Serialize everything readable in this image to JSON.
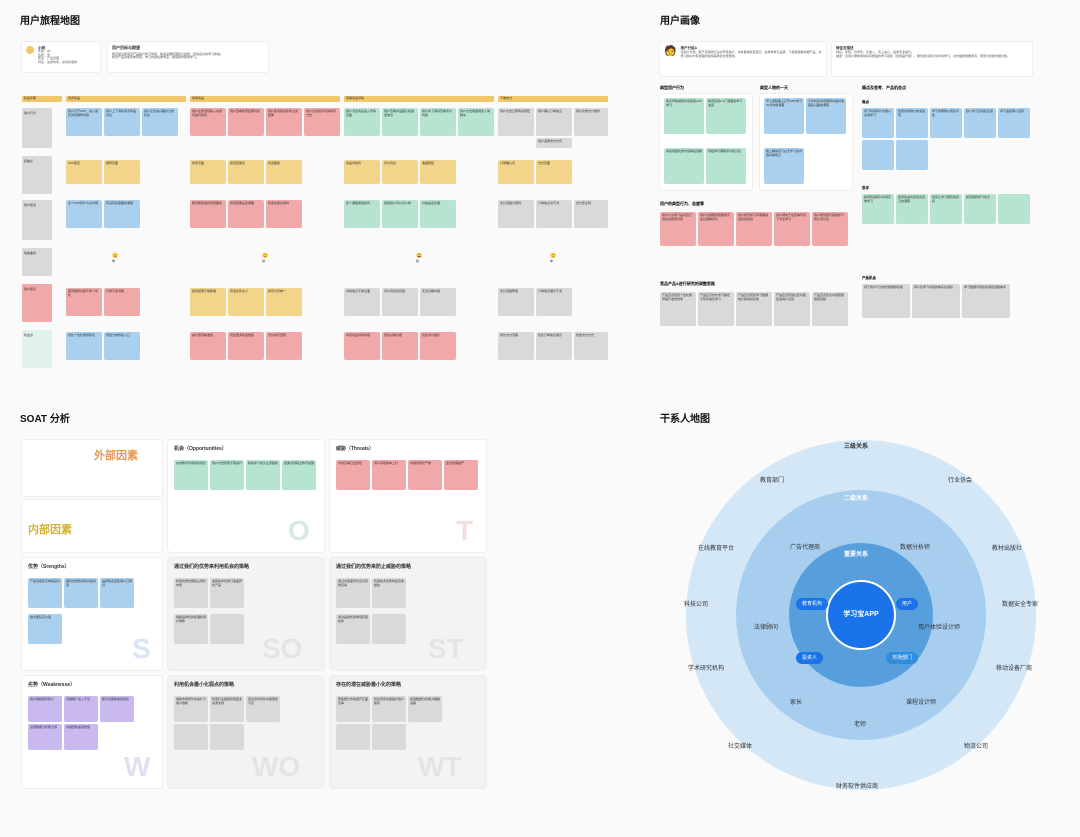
{
  "journey": {
    "title": "用户旅程地图",
    "persona": {
      "name": "小明",
      "meta": "年龄：28\n性别：男\n职业：产品经理\n特征：追求效率，喜欢新事物"
    },
    "goal": {
      "title": "用户目标与期望",
      "body": "希望通过使用该产品提升学习效率，快速掌握所需知识技能，获得良好的学习体验。\n希望产品功能简单易用，学习内容优质丰富，能够随时随地学习。"
    },
    "stageHeader": "阶段步骤",
    "stages": [
      "浏览商品",
      "搜索商品",
      "查看商品详情",
      "下单支付"
    ],
    "rows": [
      {
        "label": "用户行为",
        "cells": [
          [
            "用户打开APP，进入首页浏览推荐内容",
            "用户上下滑动浏览商品列表",
            "用户点击感兴趣的分类标签"
          ],
          [
            "用户在搜索框输入关键词进行搜索",
            "用户查看搜索结果列表",
            "用户使用筛选条件过滤结果",
            "用户点击排序切换排序方式"
          ],
          [
            "用户点击商品进入详情页面",
            "用户查看商品图片和描述信息",
            "用户向下滑动查看评价内容",
            "用户点击收藏或加入购物车"
          ],
          [
            "用户点击立即购买按钮",
            "用户确认订单信息",
            "用户选择支付方式",
            "用户完成支付操作"
          ]
        ]
      },
      {
        "label": "接触点",
        "cells": [
          [
            "APP首页",
            "推荐页面"
          ],
          [
            "搜索页面",
            "搜索结果页",
            "筛选面板"
          ],
          [
            "商品详情页",
            "评价列表",
            "收藏按钮"
          ],
          [
            "订单确认页",
            "支付页面"
          ]
        ]
      },
      {
        "label": "用户想法",
        "cells": [
          [
            "这个APP有什么好内容",
            "有没有我需要的课程"
          ],
          [
            "希望能快速找到想要的",
            "搜索结果是否准确",
            "筛选功能好用吗"
          ],
          [
            "这个课程质量如何",
            "其他用户评价怎么样",
            "价格是否合理"
          ],
          [
            "支付流程方便吗",
            "订单信息对不对",
            "支付安全吗"
          ]
        ]
      },
      {
        "label": "情绪曲线",
        "emoji": [
          "😐",
          "😊",
          "😄",
          "🙂"
        ],
        "labels": [
          "中",
          "好",
          "好",
          "中"
        ]
      },
      {
        "label": "用户痛点",
        "cells": [
          [
            "首页推荐内容不够个性化",
            "分类不够清晰"
          ],
          [
            "搜索结果不够精准",
            "筛选条件太少",
            "排序方式单一"
          ],
          [
            "详情信息不够全面",
            "评价真实性存疑",
            "无法试看内容"
          ],
          [
            "支付流程繁琐",
            "订单信息展示不清"
          ]
        ]
      },
      {
        "label": "机会点",
        "cells": [
          [
            "优化个性化推荐算法",
            "增加分类导航入口"
          ],
          [
            "提升搜索精准度",
            "增加更多筛选维度",
            "优化排序逻辑"
          ],
          [
            "丰富商品详情内容",
            "增加试看功能",
            "优化评价展示"
          ],
          [
            "简化支付流程",
            "优化订单信息展示",
            "增加支付方式"
          ]
        ]
      }
    ]
  },
  "persona": {
    "title": "用户画像",
    "card": {
      "title": "用户分组A",
      "body": "该用户分组：属于互联网行业的年轻用户，对新事物接受度高，追求效率与品质，习惯使用移动端产品，对学习类APP有较强的使用需求和付费意愿。"
    },
    "card2": {
      "title": "特征及描述",
      "body": "特征：年轻、高学历、高收入、有上进心、追求专业提升。\n描述：该用户群体通常具有较强的学习动机（自我提升型），希望通过碎片化时间学习，对内容质量要求高，愿意为优质内容付费。"
    },
    "cols": [
      {
        "title": "典型用户行为",
        "pane": "mint",
        "items": [
          "每天早晚通勤时间使用APP学习",
          "每周完成2-3门课程的学习进度",
          "",
          "喜欢收藏优质内容稍后观看",
          "积极参与课程评价和讨论"
        ]
      },
      {
        "title": "典型人物的一天",
        "pane": "skyblue",
        "items": [
          "早上通勤路上打开APP学习30分钟新课程",
          "",
          "午休时间浏览推荐内容并收藏感兴趣的课程",
          "",
          "晚上睡前复习白天学习的内容并做笔记"
        ]
      },
      {
        "title": "痛点及思考、产品机会点",
        "pane": "white",
        "sub": [
          {
            "t": "痛点",
            "color": "blue",
            "items": [
              "学习时间碎片化难以系统学习",
              "优质内容难以快速发现",
              "学习效果难以量化评估",
              "缺少学习互动和反馈",
              "学习进度难以坚持",
              "",
              ""
            ]
          },
          {
            "t": "思考",
            "color": "green",
            "items": [
              "如何利用碎片时间高效学习",
              "如何快速找到适合自己的课程",
              "如何让学习更有成就感",
              "",
              "如何保持学习动力"
            ]
          }
        ]
      }
    ],
    "row2label": "用户的典型行为、态度等",
    "row2": [
      "用户认为学习是对自己的投资愿意付费",
      "用户对课程质量要求高会仔细看评价",
      "用户希望学习有明确进度和成就感",
      "用户倾向于在安静环境下专注学习",
      "用户希望能与其他学习者交流讨论"
    ],
    "row3label": "竞品产品A进行研究的调整思路",
    "row3": [
      "产品应该增加个性化推荐提升发现效率",
      "产品应该优化学习路径引导系统化学习",
      "产品应该增加学习数据统计和成就系统",
      "产品应该增加社区功能促进用户互动",
      "产品应该优化内容质量把控机制"
    ],
    "side": {
      "label": "产品机会",
      "items": [
        "基于用户行为的智能推荐系统",
        "碎片化学习内容的体系化组织",
        "学习数据可视化和成就激励体系"
      ]
    }
  },
  "soat": {
    "title": "SOAT 分析",
    "ext": "外部因素",
    "int": "内部因素",
    "panels": {
      "O": {
        "title": "机会（Opportunities）",
        "items": [
          "在线教育市场持续增长",
          "用户付费意愿不断提升",
          "移动学习成为主流趋势",
          "政策支持职业教育发展"
        ]
      },
      "T": {
        "title": "威胁（Threats）",
        "items": [
          "市场竞争日益激烈",
          "用户获取成本上升",
          "内容同质化严重",
          "监管政策趋严"
        ]
      },
      "S": {
        "title": "优势（Srengths）",
        "items": [
          "产品功能完善体验良好",
          "拥有优质师资和内容资源",
          "品牌知名度和用户口碑好",
          "技术团队实力强"
        ]
      },
      "SO": {
        "title": "通过我们的优势来利用机会的策略",
        "items": [
          "利用优质内容抢占增长市场",
          "发挥技术优势打造差异化产品",
          "借助品牌优势拓展新用户群体",
          "",
          ""
        ]
      },
      "ST": {
        "title": "通过我们的优势来防止威胁的策略",
        "items": [
          "通过内容差异化应对同质竞争",
          "利用技术优势构建竞争壁垒",
          "通过品牌优势降低获客成本",
          "",
          ""
        ]
      },
      "W": {
        "title": "劣势（Weaknesse）",
        "items": [
          "用户规模相对较小",
          "营销推广投入不足",
          "部分功能体验待优化",
          "运营数据分析能力弱",
          "内容更新速度较慢"
        ]
      },
      "WO": {
        "title": "利用机会最小化弱点的策略",
        "items": [
          "借助市场增长快速扩大用户规模",
          "利用行业趋势获取更多资源支持",
          "通过合作弥补内容更新不足",
          "",
          ""
        ]
      },
      "WT": {
        "title": "存在的潜在威胁最小化的策略",
        "items": [
          "聚焦细分市场避开正面竞争",
          "优化现有功能提升用户留存",
          "加强数据分析能力辅助决策",
          "",
          ""
        ]
      }
    }
  },
  "stakeholder": {
    "title": "干系人地图",
    "center": "学习宝APP",
    "rings": {
      "r1": "重要关系",
      "r2": "二级关系",
      "r3": "三级关系"
    },
    "chips": [
      "教育机构",
      "用户",
      "投资人",
      "市场部门"
    ],
    "ring2": [
      "广告代理商",
      "数据分析师",
      "法律顾问",
      "用户体验设计师",
      "家长",
      "课程设计师",
      "老师"
    ],
    "ring3": [
      "教育部门",
      "行业协会",
      "在线教育平台",
      "教材出版社",
      "科技公司",
      "数据安全专家",
      "学术研究机构",
      "移动设备厂商",
      "社交媒体",
      "物流公司",
      "财务软件供应商"
    ]
  }
}
